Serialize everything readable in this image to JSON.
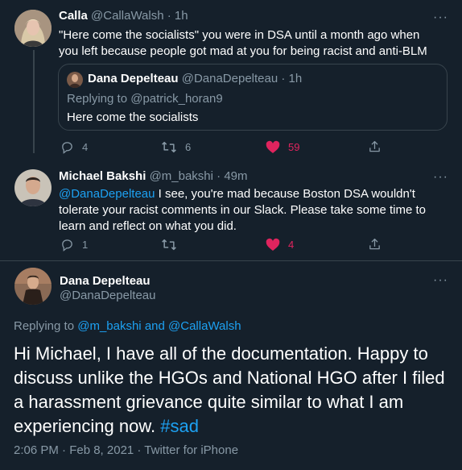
{
  "tweet1": {
    "name": "Calla",
    "handle": "@CallaWalsh",
    "time": "· 1h",
    "text": "\"Here come the socialists\" you were in DSA until a month ago when you left because people got mad at you for being racist and anti-BLM",
    "quote": {
      "name": "Dana Depelteau",
      "handle": "@DanaDepelteau",
      "time": "· 1h",
      "replying": "Replying to @patrick_horan9",
      "text": "Here come the socialists"
    },
    "replies": "4",
    "retweets": "6",
    "likes": "59"
  },
  "tweet2": {
    "name": "Michael Bakshi",
    "handle": "@m_bakshi",
    "time": "· 49m",
    "mention": "@DanaDepelteau",
    "text": " I see, you're mad because Boston DSA wouldn't tolerate your racist comments in our Slack. Please take some time to learn and reflect on what you did.",
    "replies": "1",
    "retweets": "",
    "likes": "4"
  },
  "main": {
    "name": "Dana Depelteau",
    "handle": "@DanaDepelteau",
    "replying_prefix": "Replying to ",
    "replying_user1": "@m_bakshi",
    "replying_and": " and ",
    "replying_user2": "@CallaWalsh",
    "text": "Hi Michael, I have all of the documentation. Happy to discuss unlike the HGOs and National HGO after I filed a harassment grievance quite similar to what I am experiencing now. ",
    "hashtag": "#sad",
    "meta": "2:06 PM · Feb 8, 2021 · Twitter for iPhone"
  },
  "more_icon": "···",
  "colors": {
    "background": "#15202b",
    "muted": "#8899a6",
    "link": "#1da1f2",
    "like": "#e0245e",
    "border": "#38444d"
  }
}
